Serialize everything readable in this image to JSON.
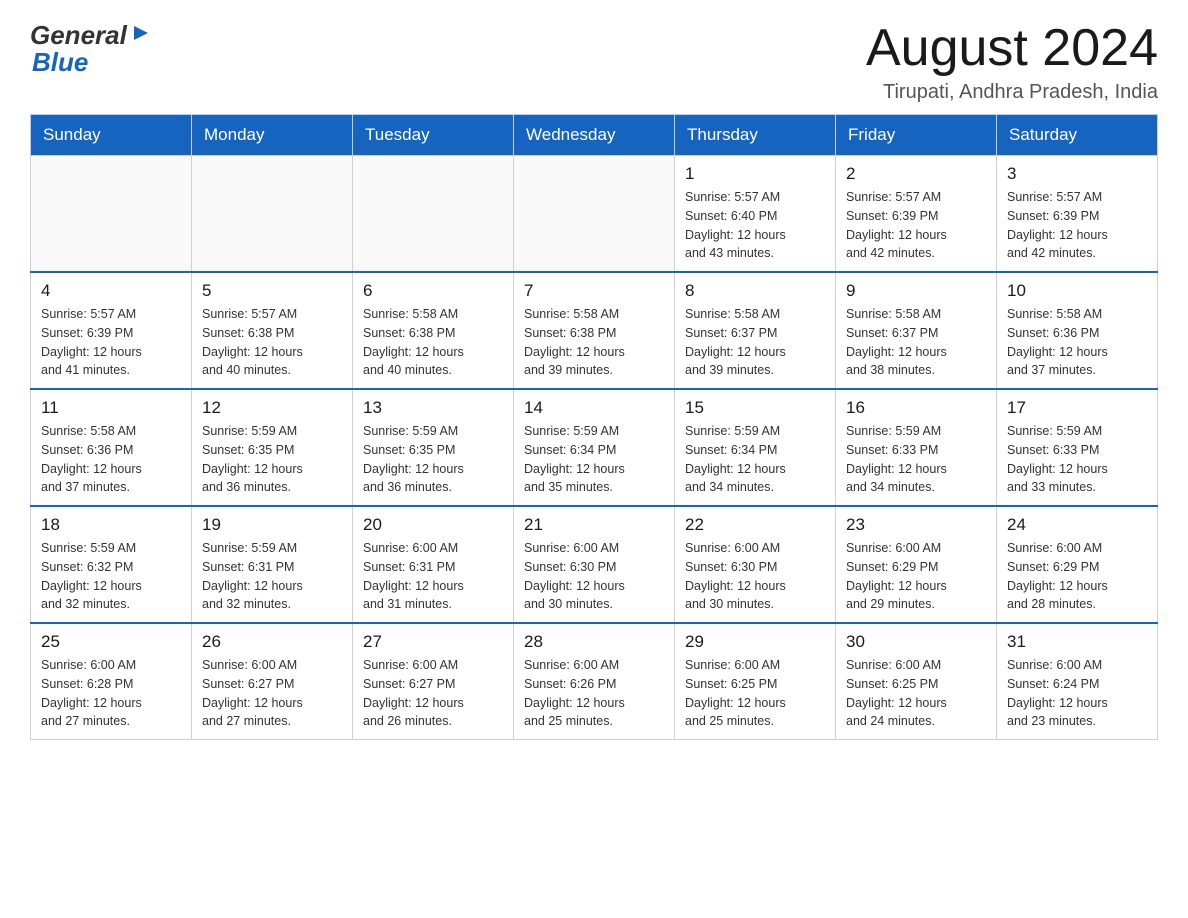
{
  "header": {
    "logo_general": "General",
    "logo_blue": "Blue",
    "month_title": "August 2024",
    "location": "Tirupati, Andhra Pradesh, India"
  },
  "weekdays": [
    "Sunday",
    "Monday",
    "Tuesday",
    "Wednesday",
    "Thursday",
    "Friday",
    "Saturday"
  ],
  "weeks": [
    {
      "days": [
        {
          "date": "",
          "info": ""
        },
        {
          "date": "",
          "info": ""
        },
        {
          "date": "",
          "info": ""
        },
        {
          "date": "",
          "info": ""
        },
        {
          "date": "1",
          "info": "Sunrise: 5:57 AM\nSunset: 6:40 PM\nDaylight: 12 hours\nand 43 minutes."
        },
        {
          "date": "2",
          "info": "Sunrise: 5:57 AM\nSunset: 6:39 PM\nDaylight: 12 hours\nand 42 minutes."
        },
        {
          "date": "3",
          "info": "Sunrise: 5:57 AM\nSunset: 6:39 PM\nDaylight: 12 hours\nand 42 minutes."
        }
      ]
    },
    {
      "days": [
        {
          "date": "4",
          "info": "Sunrise: 5:57 AM\nSunset: 6:39 PM\nDaylight: 12 hours\nand 41 minutes."
        },
        {
          "date": "5",
          "info": "Sunrise: 5:57 AM\nSunset: 6:38 PM\nDaylight: 12 hours\nand 40 minutes."
        },
        {
          "date": "6",
          "info": "Sunrise: 5:58 AM\nSunset: 6:38 PM\nDaylight: 12 hours\nand 40 minutes."
        },
        {
          "date": "7",
          "info": "Sunrise: 5:58 AM\nSunset: 6:38 PM\nDaylight: 12 hours\nand 39 minutes."
        },
        {
          "date": "8",
          "info": "Sunrise: 5:58 AM\nSunset: 6:37 PM\nDaylight: 12 hours\nand 39 minutes."
        },
        {
          "date": "9",
          "info": "Sunrise: 5:58 AM\nSunset: 6:37 PM\nDaylight: 12 hours\nand 38 minutes."
        },
        {
          "date": "10",
          "info": "Sunrise: 5:58 AM\nSunset: 6:36 PM\nDaylight: 12 hours\nand 37 minutes."
        }
      ]
    },
    {
      "days": [
        {
          "date": "11",
          "info": "Sunrise: 5:58 AM\nSunset: 6:36 PM\nDaylight: 12 hours\nand 37 minutes."
        },
        {
          "date": "12",
          "info": "Sunrise: 5:59 AM\nSunset: 6:35 PM\nDaylight: 12 hours\nand 36 minutes."
        },
        {
          "date": "13",
          "info": "Sunrise: 5:59 AM\nSunset: 6:35 PM\nDaylight: 12 hours\nand 36 minutes."
        },
        {
          "date": "14",
          "info": "Sunrise: 5:59 AM\nSunset: 6:34 PM\nDaylight: 12 hours\nand 35 minutes."
        },
        {
          "date": "15",
          "info": "Sunrise: 5:59 AM\nSunset: 6:34 PM\nDaylight: 12 hours\nand 34 minutes."
        },
        {
          "date": "16",
          "info": "Sunrise: 5:59 AM\nSunset: 6:33 PM\nDaylight: 12 hours\nand 34 minutes."
        },
        {
          "date": "17",
          "info": "Sunrise: 5:59 AM\nSunset: 6:33 PM\nDaylight: 12 hours\nand 33 minutes."
        }
      ]
    },
    {
      "days": [
        {
          "date": "18",
          "info": "Sunrise: 5:59 AM\nSunset: 6:32 PM\nDaylight: 12 hours\nand 32 minutes."
        },
        {
          "date": "19",
          "info": "Sunrise: 5:59 AM\nSunset: 6:31 PM\nDaylight: 12 hours\nand 32 minutes."
        },
        {
          "date": "20",
          "info": "Sunrise: 6:00 AM\nSunset: 6:31 PM\nDaylight: 12 hours\nand 31 minutes."
        },
        {
          "date": "21",
          "info": "Sunrise: 6:00 AM\nSunset: 6:30 PM\nDaylight: 12 hours\nand 30 minutes."
        },
        {
          "date": "22",
          "info": "Sunrise: 6:00 AM\nSunset: 6:30 PM\nDaylight: 12 hours\nand 30 minutes."
        },
        {
          "date": "23",
          "info": "Sunrise: 6:00 AM\nSunset: 6:29 PM\nDaylight: 12 hours\nand 29 minutes."
        },
        {
          "date": "24",
          "info": "Sunrise: 6:00 AM\nSunset: 6:29 PM\nDaylight: 12 hours\nand 28 minutes."
        }
      ]
    },
    {
      "days": [
        {
          "date": "25",
          "info": "Sunrise: 6:00 AM\nSunset: 6:28 PM\nDaylight: 12 hours\nand 27 minutes."
        },
        {
          "date": "26",
          "info": "Sunrise: 6:00 AM\nSunset: 6:27 PM\nDaylight: 12 hours\nand 27 minutes."
        },
        {
          "date": "27",
          "info": "Sunrise: 6:00 AM\nSunset: 6:27 PM\nDaylight: 12 hours\nand 26 minutes."
        },
        {
          "date": "28",
          "info": "Sunrise: 6:00 AM\nSunset: 6:26 PM\nDaylight: 12 hours\nand 25 minutes."
        },
        {
          "date": "29",
          "info": "Sunrise: 6:00 AM\nSunset: 6:25 PM\nDaylight: 12 hours\nand 25 minutes."
        },
        {
          "date": "30",
          "info": "Sunrise: 6:00 AM\nSunset: 6:25 PM\nDaylight: 12 hours\nand 24 minutes."
        },
        {
          "date": "31",
          "info": "Sunrise: 6:00 AM\nSunset: 6:24 PM\nDaylight: 12 hours\nand 23 minutes."
        }
      ]
    }
  ]
}
